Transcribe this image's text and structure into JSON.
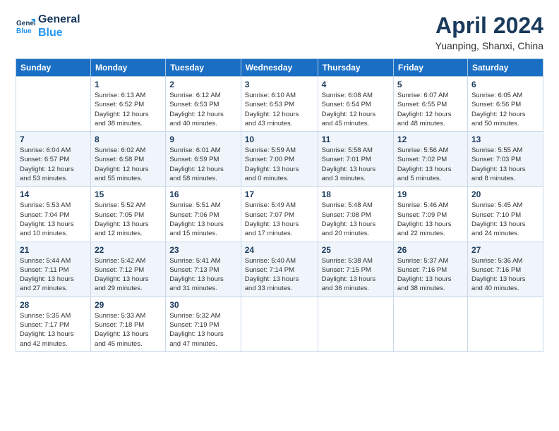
{
  "header": {
    "logo_line1": "General",
    "logo_line2": "Blue",
    "month": "April 2024",
    "location": "Yuanping, Shanxi, China"
  },
  "weekdays": [
    "Sunday",
    "Monday",
    "Tuesday",
    "Wednesday",
    "Thursday",
    "Friday",
    "Saturday"
  ],
  "weeks": [
    [
      {
        "day": "",
        "info": ""
      },
      {
        "day": "1",
        "info": "Sunrise: 6:13 AM\nSunset: 6:52 PM\nDaylight: 12 hours\nand 38 minutes."
      },
      {
        "day": "2",
        "info": "Sunrise: 6:12 AM\nSunset: 6:53 PM\nDaylight: 12 hours\nand 40 minutes."
      },
      {
        "day": "3",
        "info": "Sunrise: 6:10 AM\nSunset: 6:53 PM\nDaylight: 12 hours\nand 43 minutes."
      },
      {
        "day": "4",
        "info": "Sunrise: 6:08 AM\nSunset: 6:54 PM\nDaylight: 12 hours\nand 45 minutes."
      },
      {
        "day": "5",
        "info": "Sunrise: 6:07 AM\nSunset: 6:55 PM\nDaylight: 12 hours\nand 48 minutes."
      },
      {
        "day": "6",
        "info": "Sunrise: 6:05 AM\nSunset: 6:56 PM\nDaylight: 12 hours\nand 50 minutes."
      }
    ],
    [
      {
        "day": "7",
        "info": "Sunrise: 6:04 AM\nSunset: 6:57 PM\nDaylight: 12 hours\nand 53 minutes."
      },
      {
        "day": "8",
        "info": "Sunrise: 6:02 AM\nSunset: 6:58 PM\nDaylight: 12 hours\nand 55 minutes."
      },
      {
        "day": "9",
        "info": "Sunrise: 6:01 AM\nSunset: 6:59 PM\nDaylight: 12 hours\nand 58 minutes."
      },
      {
        "day": "10",
        "info": "Sunrise: 5:59 AM\nSunset: 7:00 PM\nDaylight: 13 hours\nand 0 minutes."
      },
      {
        "day": "11",
        "info": "Sunrise: 5:58 AM\nSunset: 7:01 PM\nDaylight: 13 hours\nand 3 minutes."
      },
      {
        "day": "12",
        "info": "Sunrise: 5:56 AM\nSunset: 7:02 PM\nDaylight: 13 hours\nand 5 minutes."
      },
      {
        "day": "13",
        "info": "Sunrise: 5:55 AM\nSunset: 7:03 PM\nDaylight: 13 hours\nand 8 minutes."
      }
    ],
    [
      {
        "day": "14",
        "info": "Sunrise: 5:53 AM\nSunset: 7:04 PM\nDaylight: 13 hours\nand 10 minutes."
      },
      {
        "day": "15",
        "info": "Sunrise: 5:52 AM\nSunset: 7:05 PM\nDaylight: 13 hours\nand 12 minutes."
      },
      {
        "day": "16",
        "info": "Sunrise: 5:51 AM\nSunset: 7:06 PM\nDaylight: 13 hours\nand 15 minutes."
      },
      {
        "day": "17",
        "info": "Sunrise: 5:49 AM\nSunset: 7:07 PM\nDaylight: 13 hours\nand 17 minutes."
      },
      {
        "day": "18",
        "info": "Sunrise: 5:48 AM\nSunset: 7:08 PM\nDaylight: 13 hours\nand 20 minutes."
      },
      {
        "day": "19",
        "info": "Sunrise: 5:46 AM\nSunset: 7:09 PM\nDaylight: 13 hours\nand 22 minutes."
      },
      {
        "day": "20",
        "info": "Sunrise: 5:45 AM\nSunset: 7:10 PM\nDaylight: 13 hours\nand 24 minutes."
      }
    ],
    [
      {
        "day": "21",
        "info": "Sunrise: 5:44 AM\nSunset: 7:11 PM\nDaylight: 13 hours\nand 27 minutes."
      },
      {
        "day": "22",
        "info": "Sunrise: 5:42 AM\nSunset: 7:12 PM\nDaylight: 13 hours\nand 29 minutes."
      },
      {
        "day": "23",
        "info": "Sunrise: 5:41 AM\nSunset: 7:13 PM\nDaylight: 13 hours\nand 31 minutes."
      },
      {
        "day": "24",
        "info": "Sunrise: 5:40 AM\nSunset: 7:14 PM\nDaylight: 13 hours\nand 33 minutes."
      },
      {
        "day": "25",
        "info": "Sunrise: 5:38 AM\nSunset: 7:15 PM\nDaylight: 13 hours\nand 36 minutes."
      },
      {
        "day": "26",
        "info": "Sunrise: 5:37 AM\nSunset: 7:16 PM\nDaylight: 13 hours\nand 38 minutes."
      },
      {
        "day": "27",
        "info": "Sunrise: 5:36 AM\nSunset: 7:16 PM\nDaylight: 13 hours\nand 40 minutes."
      }
    ],
    [
      {
        "day": "28",
        "info": "Sunrise: 5:35 AM\nSunset: 7:17 PM\nDaylight: 13 hours\nand 42 minutes."
      },
      {
        "day": "29",
        "info": "Sunrise: 5:33 AM\nSunset: 7:18 PM\nDaylight: 13 hours\nand 45 minutes."
      },
      {
        "day": "30",
        "info": "Sunrise: 5:32 AM\nSunset: 7:19 PM\nDaylight: 13 hours\nand 47 minutes."
      },
      {
        "day": "",
        "info": ""
      },
      {
        "day": "",
        "info": ""
      },
      {
        "day": "",
        "info": ""
      },
      {
        "day": "",
        "info": ""
      }
    ]
  ]
}
